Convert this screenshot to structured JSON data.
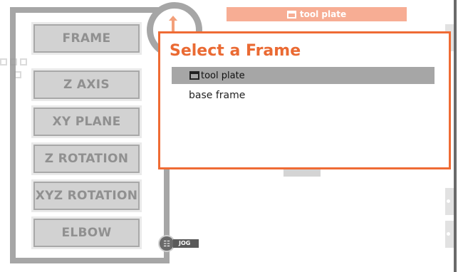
{
  "top_chip": {
    "label": "tool plate",
    "icon": "tool-plate-icon"
  },
  "jog": {
    "label": "JOG",
    "icon": "jog-grid-icon"
  },
  "mode_buttons": [
    {
      "label": "FRAME"
    },
    {
      "label": "Z AXIS"
    },
    {
      "label": "XY PLANE"
    },
    {
      "label": "Z ROTATION"
    },
    {
      "label": "XYZ ROTATION"
    },
    {
      "label": "ELBOW"
    }
  ],
  "modal": {
    "title": "Select a Frame",
    "items": [
      {
        "label": "tool plate",
        "selected": true,
        "icon": "tool-plate-icon"
      },
      {
        "label": "base frame",
        "selected": false
      }
    ]
  },
  "colors": {
    "accent": "#ef6b34",
    "chip": "#f7ad94",
    "selected_row": "#a6a6a6"
  }
}
